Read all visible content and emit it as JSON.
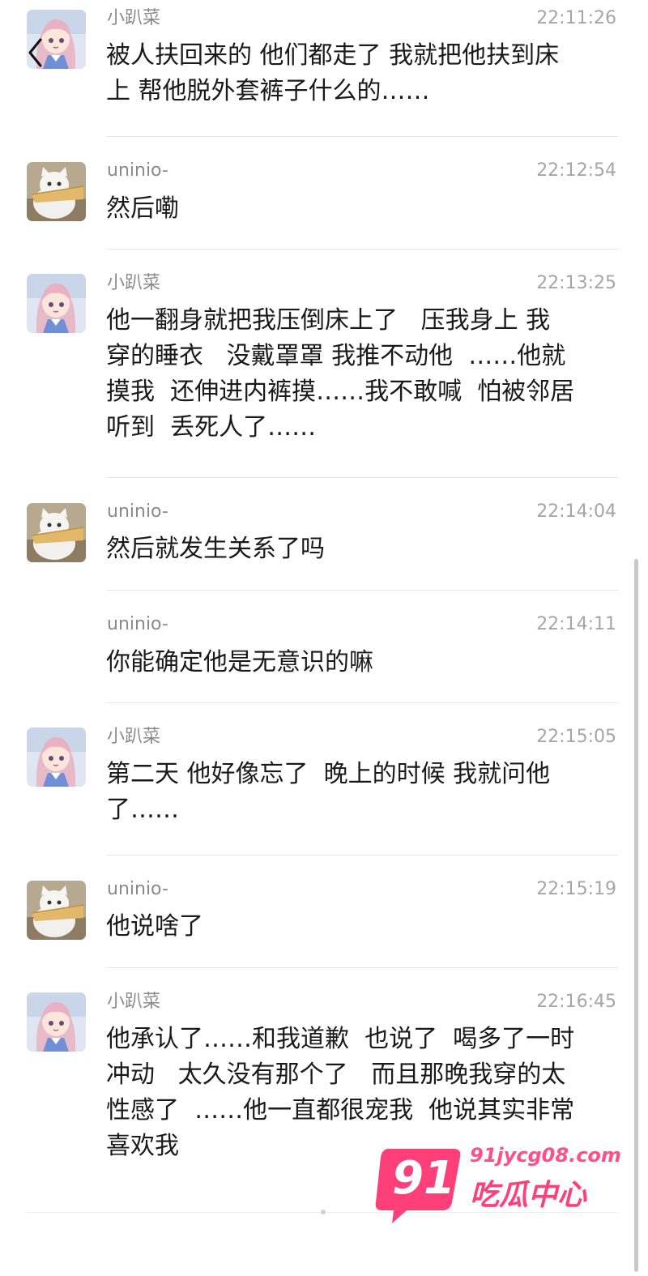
{
  "nav": {
    "back_icon": "chevron-left-icon"
  },
  "messages": [
    {
      "sender": "小趴菜",
      "avatar": "girl",
      "time": "22:11:26",
      "text": "被人扶回来的 他们都走了 我就把他扶到床\n上 帮他脱外套裤子什么的……"
    },
    {
      "sender": "uninio-",
      "avatar": "cat",
      "time": "22:12:54",
      "text": "然后嘞"
    },
    {
      "sender": "小趴菜",
      "avatar": "girl",
      "time": "22:13:25",
      "text": "他一翻身就把我压倒床上了   压我身上 我\n穿的睡衣   没戴罩罩 我推不动他  ……他就\n摸我  还伸进内裤摸……我不敢喊  怕被邻居\n听到  丢死人了……"
    },
    {
      "sender": "uninio-",
      "avatar": "cat",
      "time": "22:14:04",
      "text": "然后就发生关系了吗"
    },
    {
      "sender": "uninio-",
      "avatar": "none",
      "time": "22:14:11",
      "text": "你能确定他是无意识的嘛"
    },
    {
      "sender": "小趴菜",
      "avatar": "girl",
      "time": "22:15:05",
      "text": "第二天 他好像忘了  晚上的时候 我就问他\n了……"
    },
    {
      "sender": "uninio-",
      "avatar": "cat",
      "time": "22:15:19",
      "text": "他说啥了"
    },
    {
      "sender": "小趴菜",
      "avatar": "girl",
      "time": "22:16:45",
      "text": "他承认了……和我道歉  也说了  喝多了一时\n冲动   太久没有那个了   而且那晚我穿的太\n性感了  ……他一直都很宠我  他说其实非常\n喜欢我"
    }
  ],
  "watermark": {
    "number": "91",
    "url": "91jycg08.com",
    "name": "吃瓜中心",
    "color": "#ff3f7a"
  }
}
